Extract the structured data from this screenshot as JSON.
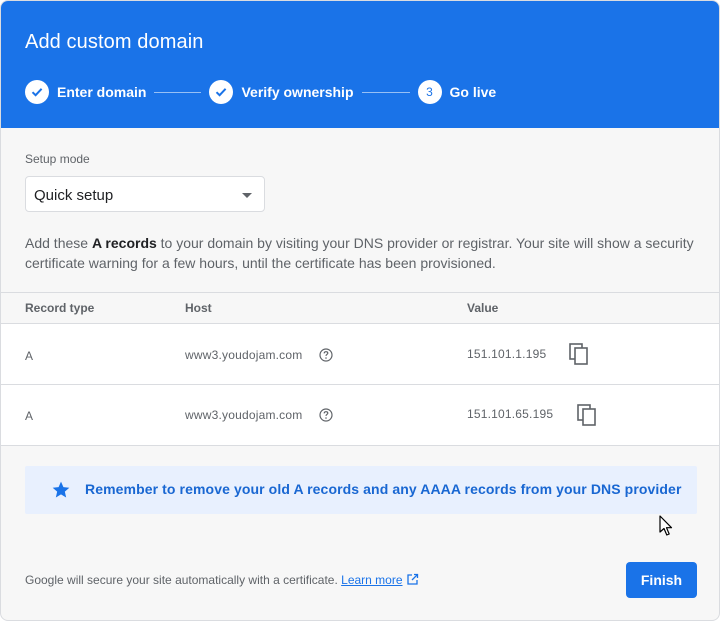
{
  "dialog": {
    "title": "Add custom domain"
  },
  "steps": [
    {
      "label": "Enter domain",
      "state": "done"
    },
    {
      "label": "Verify ownership",
      "state": "done"
    },
    {
      "label": "Go live",
      "state": "active",
      "number": "3"
    }
  ],
  "setup": {
    "label": "Setup mode",
    "value": "Quick setup"
  },
  "description": {
    "before": "Add these ",
    "bold": "A records",
    "after": " to your domain by visiting your DNS provider or registrar. Your site will show a security certificate warning for a few hours, until the certificate has been provisioned."
  },
  "table": {
    "headers": {
      "type": "Record type",
      "host": "Host",
      "value": "Value"
    },
    "rows": [
      {
        "type": "A",
        "host": "www3.youdojam.com",
        "value": "151.101.1.195"
      },
      {
        "type": "A",
        "host": "www3.youdojam.com",
        "value": "151.101.65.195"
      }
    ]
  },
  "notice": {
    "text": "Remember to remove your old A records and any AAAA records from your DNS provider",
    "icon": "star-icon"
  },
  "footer": {
    "text": "Google will secure your site automatically with a certificate. ",
    "link": "Learn more"
  },
  "actions": {
    "finish": "Finish"
  },
  "colors": {
    "primary": "#1a73e8",
    "notice_bg": "#e8f0fe",
    "notice_text": "#1967d2"
  }
}
